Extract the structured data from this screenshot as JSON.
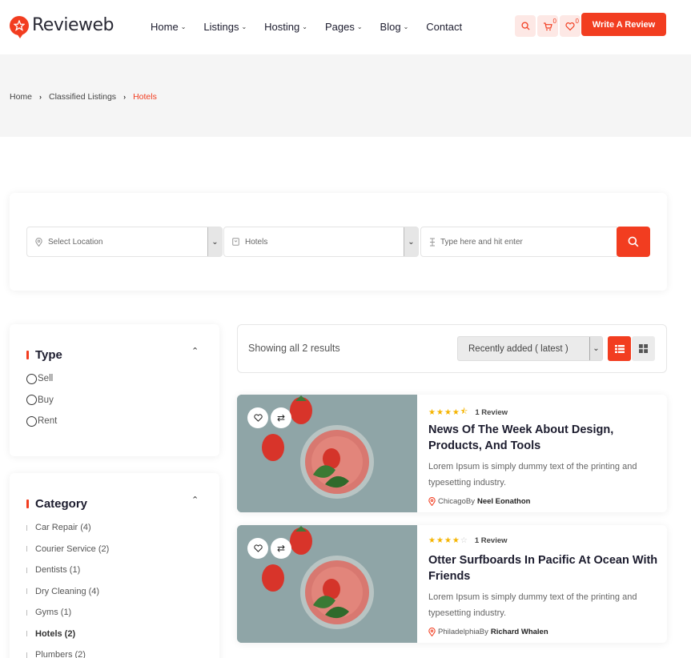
{
  "brand": {
    "name": "Revieweb",
    "accent": "#f23d20"
  },
  "nav": {
    "items": [
      {
        "label": "Home",
        "has_dropdown": true
      },
      {
        "label": "Listings",
        "has_dropdown": true
      },
      {
        "label": "Hosting",
        "has_dropdown": true
      },
      {
        "label": "Pages",
        "has_dropdown": true
      },
      {
        "label": "Blog",
        "has_dropdown": true
      },
      {
        "label": "Contact",
        "has_dropdown": false
      }
    ],
    "cart_count": "0",
    "wishlist_count": "0",
    "write_review_label": "Write A Review"
  },
  "breadcrumb": {
    "items": [
      "Home",
      "Classified Listings"
    ],
    "current": "Hotels"
  },
  "search": {
    "location_placeholder": "Select Location",
    "category_value": "Hotels",
    "keyword_placeholder": "Type here and hit enter"
  },
  "sidebar": {
    "type": {
      "title": "Type",
      "options": [
        "Sell",
        "Buy",
        "Rent"
      ]
    },
    "category": {
      "title": "Category",
      "items": [
        {
          "label": "Car Repair (4)",
          "active": false
        },
        {
          "label": "Courier Service (2)",
          "active": false
        },
        {
          "label": "Dentists (1)",
          "active": false
        },
        {
          "label": "Dry Cleaning (4)",
          "active": false
        },
        {
          "label": "Gyms (1)",
          "active": false
        },
        {
          "label": "Hotels (2)",
          "active": true
        },
        {
          "label": "Plumbers (2)",
          "active": false
        }
      ]
    }
  },
  "results": {
    "showing_text": "Showing all 2 results",
    "sort_value": "Recently added ( latest )",
    "view_mode": "list"
  },
  "listings": [
    {
      "rating": 4.5,
      "reviews": "1 Review",
      "title": "News Of The Week About Design, Products, And Tools",
      "description": "Lorem Ipsum is simply dummy text of the printing and typesetting industry.",
      "location": "Chicago",
      "by_label": "By",
      "author": "Neel Eonathon"
    },
    {
      "rating": 4,
      "reviews": "1 Review",
      "title": "Otter Surfboards In Pacific At Ocean With Friends",
      "description": "Lorem Ipsum is simply dummy text of the printing and typesetting industry.",
      "location": "Philadelphia",
      "by_label": "By",
      "author": "Richard Whalen"
    }
  ]
}
